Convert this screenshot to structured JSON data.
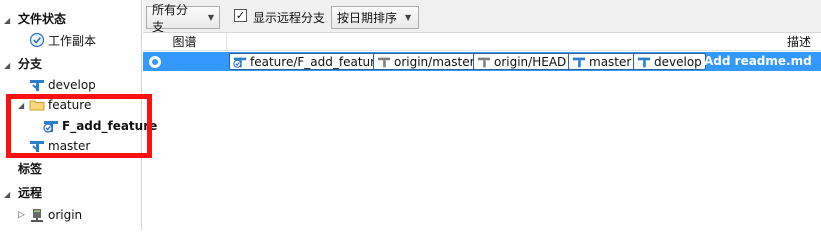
{
  "sidebar": {
    "workspace_title": "文件状态",
    "working_copy": "工作副本",
    "branches_title": "分支",
    "branch_develop": "develop",
    "folder_feature": "feature",
    "branch_feature_add": "F_add_feature",
    "branch_master": "master",
    "tags_title": "标签",
    "remotes_title": "远程",
    "remote_origin": "origin"
  },
  "toolbar": {
    "branch_filter": "所有分支",
    "show_remote_label": "显示远程分支",
    "show_remote_checked": true,
    "sort_order": "按日期排序"
  },
  "columns": {
    "graph": "图谱",
    "description": "描述"
  },
  "commit": {
    "refs": [
      {
        "label": "feature/F_add_feature",
        "type": "local-current"
      },
      {
        "label": "origin/master",
        "type": "remote"
      },
      {
        "label": "origin/HEAD",
        "type": "remote"
      },
      {
        "label": "master",
        "type": "local"
      },
      {
        "label": "develop",
        "type": "local"
      }
    ],
    "message": "Add readme.md"
  },
  "colors": {
    "selection": "#3399ff",
    "highlight_box": "#ff1010",
    "branch_icon": "#2a7fd0"
  }
}
